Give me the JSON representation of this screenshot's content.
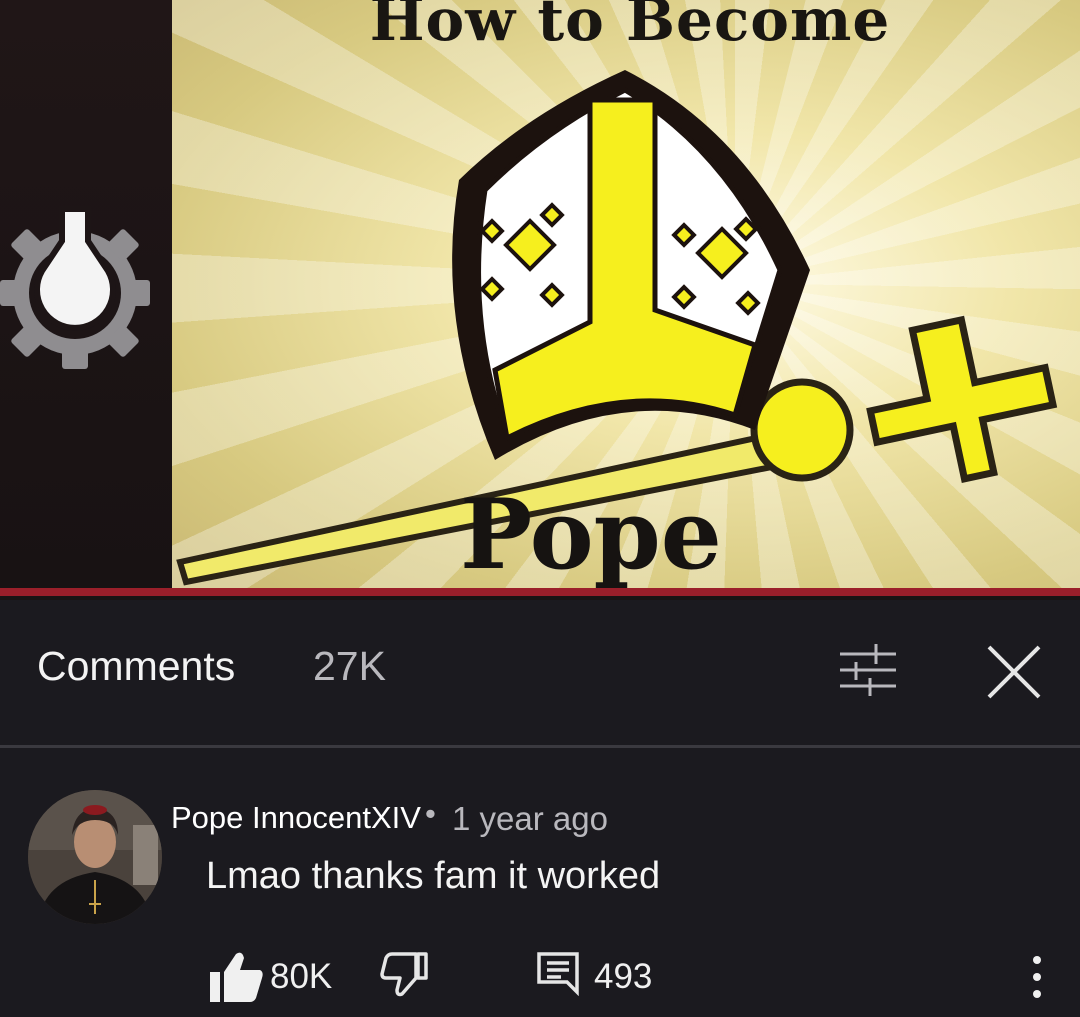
{
  "video": {
    "thumbnail_title_line1": "How to Become",
    "thumbnail_title_line2": "Pope",
    "progress_fraction": 1.0
  },
  "comments_panel": {
    "title": "Comments",
    "count": "27K",
    "filter_icon": "sort-filter-icon",
    "close_icon": "close-icon"
  },
  "comment": {
    "author": "Pope InnocentXIV",
    "separator": "•",
    "time": "1 year ago",
    "text": "Lmao thanks fam it worked",
    "likes": "80K",
    "replies": "493",
    "icons": {
      "like": "thumbs-up-icon",
      "dislike": "thumbs-down-icon",
      "reply": "reply-icon",
      "more": "more-vertical-icon"
    }
  },
  "colors": {
    "background": "#1b1a1f",
    "progress": "#9b1f2a",
    "text_primary": "#ffffff",
    "text_secondary": "#b9b8bd",
    "thumbnail_yellow": "#f6ef1e"
  }
}
